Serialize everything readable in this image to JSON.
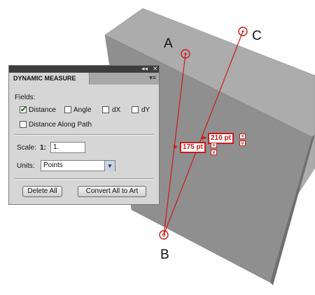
{
  "panel": {
    "collapse_icon": "double-chevron-icon",
    "close_icon": "close-icon",
    "tab_title": "DYNAMIC MEASURE",
    "menu_icon": "panel-menu-icon",
    "fields_label": "Fields:",
    "checkboxes": [
      {
        "label": "Distance",
        "checked": true
      },
      {
        "label": "Angle",
        "checked": false
      },
      {
        "label": "dX",
        "checked": false
      },
      {
        "label": "dY",
        "checked": false
      },
      {
        "label": "Distance Along Path",
        "checked": false
      }
    ],
    "scale_label": "Scale:",
    "scale_prefix": "1:",
    "scale_value": "1.",
    "units_label": "Units:",
    "units_value": "Points",
    "delete_all_label": "Delete All",
    "convert_label": "Convert All to Art"
  },
  "points": {
    "a": "A",
    "b": "B",
    "c": "C"
  },
  "measurements": {
    "ab": "175 pt",
    "bc": "210 pt"
  },
  "colors": {
    "accent": "#cc1a1a",
    "panel_bg": "#d6d6d6",
    "shape_light": "#acacac",
    "shape_dark": "#8f8f8f"
  }
}
